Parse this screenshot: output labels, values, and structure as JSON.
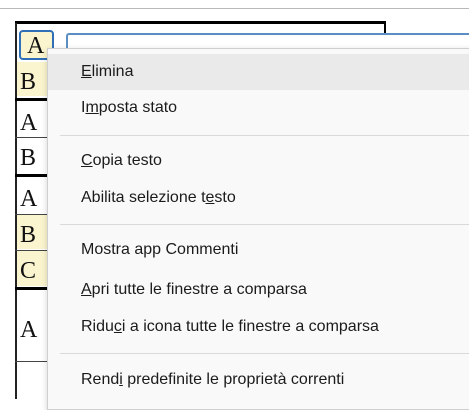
{
  "document": {
    "cells": [
      "B",
      "A",
      "B",
      "A",
      "B",
      "C",
      "A"
    ],
    "selected_cell": "A",
    "highlight_color": "#fbf5cf",
    "selection_color": "#2f6fb8"
  },
  "context_menu": {
    "groups": [
      [
        {
          "label": "Elimina",
          "accel_index": 0
        },
        {
          "label": "Imposta stato",
          "accel_index": 1
        }
      ],
      [
        {
          "label": "Copia testo",
          "accel_index": 0
        },
        {
          "label": "Abilita selezione testo",
          "accel_index": 19
        }
      ],
      [
        {
          "label": "Mostra app Commenti",
          "accel_index": -1
        },
        {
          "label": "Apri tutte le finestre a comparsa",
          "accel_index": 0
        },
        {
          "label": "Riduci a icona tutte le finestre a comparsa",
          "accel_index": 4
        }
      ],
      [
        {
          "label": "Rendi predefinite le proprietà correnti",
          "accel_index": 4
        }
      ]
    ]
  }
}
